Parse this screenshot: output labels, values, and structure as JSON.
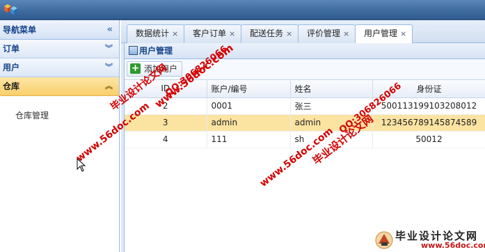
{
  "sidebar": {
    "title": "导航菜单",
    "sections": [
      {
        "label": "订单"
      },
      {
        "label": "用户"
      },
      {
        "label": "仓库"
      }
    ],
    "active_items": [
      "仓库管理"
    ]
  },
  "tabs": [
    {
      "label": "数据统计"
    },
    {
      "label": "客户订单"
    },
    {
      "label": "配送任务"
    },
    {
      "label": "评价管理"
    },
    {
      "label": "用户管理"
    }
  ],
  "panel": {
    "title": "用户管理",
    "add_label": "添加用户"
  },
  "grid": {
    "columns": [
      "ID",
      "账户/编号",
      "姓名",
      "身份证"
    ],
    "rows": [
      [
        "2",
        "0001",
        "张三",
        "500113199103208012"
      ],
      [
        "3",
        "admin",
        "admin",
        "123456789145874589"
      ],
      [
        "4",
        "111",
        "sh",
        "50012"
      ]
    ],
    "selected_row": 1
  },
  "watermarks": {
    "site": "www.56doc.com",
    "qq": "QQ:306826066",
    "name": "毕业设计论文网",
    "brand_url": "www.56doc.com"
  },
  "colors": {
    "accent": "#15428b",
    "selected": "#fbe3a2",
    "watermark": "#d40000"
  }
}
